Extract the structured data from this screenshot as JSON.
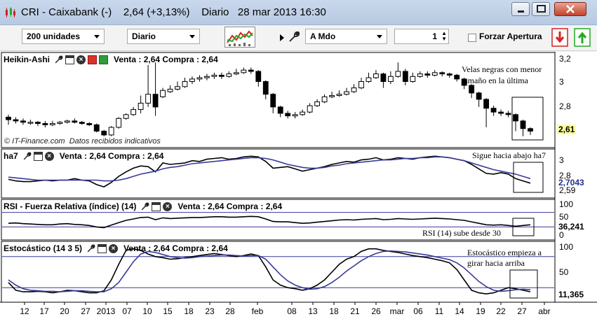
{
  "window": {
    "title": "CRI - Caixabank (-)",
    "quote": "2,64 (+3,13%)",
    "period": "Diario",
    "datetime": "28 mar 2013 16:30"
  },
  "toolbar": {
    "units": "200 unidades",
    "period": "Diario",
    "market": "A Mdo",
    "quantity": "1",
    "forzar_label": "Forzar Apertura"
  },
  "panels": {
    "price": {
      "name": "Heikin-Ashi",
      "quote": "Venta : 2,64 Compra : 2,64",
      "y_ticks": [
        "3,2",
        "3",
        "2,8"
      ],
      "last_value": "2,61",
      "credit_source": "© IT-Finance.com",
      "credit_note": "Datos recibidos indicativos",
      "annotation_line1": "Velas negras con menor",
      "annotation_line2": "tamaño en la última"
    },
    "ha7": {
      "name": "ha7",
      "quote": "Venta : 2,64 Compra : 2,64",
      "y_ticks": [
        "3",
        "2,8"
      ],
      "value_blue": "2,7043",
      "value_black": "2,59",
      "annotation": "Sigue hacia abajo ha7"
    },
    "rsi": {
      "name": "RSI - Fuerza Relativa (índice) (14)",
      "quote": "Venta : 2,64 Compra : 2,64",
      "y_ticks": [
        "100",
        "50",
        "0"
      ],
      "value": "36,241",
      "annotation": "RSI (14) sube desde 30"
    },
    "stoch": {
      "name": "Estocástico (14 3 5)",
      "quote": "Venta : 2,64 Compra : 2,64",
      "y_ticks": [
        "100",
        "50"
      ],
      "value": "11,365",
      "annotation_line1": "Estocástico empieza a",
      "annotation_line2": "girar  hacia arriba"
    }
  },
  "x_axis": [
    "12",
    "17",
    "20",
    "27",
    "2013",
    "07",
    "10",
    "15",
    "18",
    "23",
    "28",
    "feb",
    "08",
    "13",
    "18",
    "21",
    "26",
    "mar",
    "06",
    "11",
    "14",
    "19",
    "22",
    "27",
    "abr"
  ],
  "colors": {
    "bull_candle": "#ffffff",
    "bear_candle": "#000000",
    "ha7_blue": "#3a3a9a",
    "last_tag_bg": "#ffff99",
    "value_tag_blue": "#1f2f8f"
  },
  "chart_data": [
    {
      "type": "candlestick",
      "title": "Heikin-Ashi",
      "ylim": [
        2.58,
        3.24
      ],
      "candles": [
        {
          "o": 2.77,
          "c": 2.75,
          "h": 2.79,
          "l": 2.71
        },
        {
          "o": 2.75,
          "c": 2.74,
          "h": 2.77,
          "l": 2.72
        },
        {
          "o": 2.74,
          "c": 2.73,
          "h": 2.76,
          "l": 2.71
        },
        {
          "o": 2.73,
          "c": 2.73,
          "h": 2.75,
          "l": 2.71
        },
        {
          "o": 2.73,
          "c": 2.72,
          "h": 2.74,
          "l": 2.7
        },
        {
          "o": 2.72,
          "c": 2.71,
          "h": 2.74,
          "l": 2.69
        },
        {
          "o": 2.71,
          "c": 2.72,
          "h": 2.74,
          "l": 2.7
        },
        {
          "o": 2.72,
          "c": 2.73,
          "h": 2.74,
          "l": 2.71
        },
        {
          "o": 2.73,
          "c": 2.74,
          "h": 2.75,
          "l": 2.72
        },
        {
          "o": 2.74,
          "c": 2.73,
          "h": 2.76,
          "l": 2.72
        },
        {
          "o": 2.73,
          "c": 2.72,
          "h": 2.74,
          "l": 2.71
        },
        {
          "o": 2.72,
          "c": 2.71,
          "h": 2.73,
          "l": 2.7
        },
        {
          "o": 2.71,
          "c": 2.66,
          "h": 2.72,
          "l": 2.65
        },
        {
          "o": 2.66,
          "c": 2.63,
          "h": 2.67,
          "l": 2.62
        },
        {
          "o": 2.63,
          "c": 2.69,
          "h": 2.7,
          "l": 2.62
        },
        {
          "o": 2.69,
          "c": 2.76,
          "h": 2.77,
          "l": 2.68
        },
        {
          "o": 2.76,
          "c": 2.79,
          "h": 2.8,
          "l": 2.75
        },
        {
          "o": 2.79,
          "c": 2.83,
          "h": 2.85,
          "l": 2.78
        },
        {
          "o": 2.83,
          "c": 2.88,
          "h": 2.94,
          "l": 2.8
        },
        {
          "o": 2.88,
          "c": 2.95,
          "h": 3.18,
          "l": 2.85
        },
        {
          "o": 2.95,
          "c": 2.85,
          "h": 3.2,
          "l": 2.78
        },
        {
          "o": 2.93,
          "c": 2.98,
          "h": 3.0,
          "l": 2.92
        },
        {
          "o": 2.97,
          "c": 2.99,
          "h": 3.02,
          "l": 2.96
        },
        {
          "o": 2.99,
          "c": 3.01,
          "h": 3.05,
          "l": 2.98
        },
        {
          "o": 3.01,
          "c": 3.05,
          "h": 3.08,
          "l": 3.0
        },
        {
          "o": 3.05,
          "c": 3.07,
          "h": 3.09,
          "l": 3.03
        },
        {
          "o": 3.07,
          "c": 3.08,
          "h": 3.1,
          "l": 3.05
        },
        {
          "o": 3.08,
          "c": 3.09,
          "h": 3.11,
          "l": 3.06
        },
        {
          "o": 3.09,
          "c": 3.1,
          "h": 3.12,
          "l": 3.07
        },
        {
          "o": 3.1,
          "c": 3.09,
          "h": 3.12,
          "l": 3.07
        },
        {
          "o": 3.09,
          "c": 3.11,
          "h": 3.13,
          "l": 3.08
        },
        {
          "o": 3.11,
          "c": 3.12,
          "h": 3.15,
          "l": 3.1
        },
        {
          "o": 3.12,
          "c": 3.14,
          "h": 3.16,
          "l": 3.11
        },
        {
          "o": 3.14,
          "c": 3.13,
          "h": 3.16,
          "l": 3.11
        },
        {
          "o": 3.13,
          "c": 3.05,
          "h": 3.14,
          "l": 3.01
        },
        {
          "o": 3.05,
          "c": 2.95,
          "h": 3.06,
          "l": 2.91
        },
        {
          "o": 2.95,
          "c": 2.85,
          "h": 2.96,
          "l": 2.8
        },
        {
          "o": 2.85,
          "c": 2.8,
          "h": 2.86,
          "l": 2.77
        },
        {
          "o": 2.8,
          "c": 2.78,
          "h": 2.82,
          "l": 2.76
        },
        {
          "o": 2.78,
          "c": 2.79,
          "h": 2.81,
          "l": 2.76
        },
        {
          "o": 2.79,
          "c": 2.81,
          "h": 2.83,
          "l": 2.78
        },
        {
          "o": 2.81,
          "c": 2.86,
          "h": 2.88,
          "l": 2.8
        },
        {
          "o": 2.86,
          "c": 2.89,
          "h": 2.91,
          "l": 2.85
        },
        {
          "o": 2.89,
          "c": 2.93,
          "h": 2.95,
          "l": 2.88
        },
        {
          "o": 2.93,
          "c": 2.94,
          "h": 2.97,
          "l": 2.92
        },
        {
          "o": 2.94,
          "c": 2.95,
          "h": 2.98,
          "l": 2.93
        },
        {
          "o": 2.95,
          "c": 2.97,
          "h": 3.0,
          "l": 2.94
        },
        {
          "o": 2.97,
          "c": 3.0,
          "h": 3.03,
          "l": 2.96
        },
        {
          "o": 3.0,
          "c": 3.05,
          "h": 3.08,
          "l": 2.99
        },
        {
          "o": 3.05,
          "c": 3.08,
          "h": 3.12,
          "l": 3.04
        },
        {
          "o": 3.08,
          "c": 3.11,
          "h": 3.14,
          "l": 3.07
        },
        {
          "o": 3.11,
          "c": 3.05,
          "h": 3.12,
          "l": 3.0
        },
        {
          "o": 3.05,
          "c": 3.09,
          "h": 3.13,
          "l": 3.03
        },
        {
          "o": 3.09,
          "c": 3.13,
          "h": 3.2,
          "l": 3.08
        },
        {
          "o": 3.13,
          "c": 3.05,
          "h": 3.15,
          "l": 3.02
        },
        {
          "o": 3.05,
          "c": 3.09,
          "h": 3.12,
          "l": 3.04
        },
        {
          "o": 3.09,
          "c": 3.11,
          "h": 3.13,
          "l": 3.08
        },
        {
          "o": 3.11,
          "c": 3.1,
          "h": 3.13,
          "l": 3.08
        },
        {
          "o": 3.1,
          "c": 3.12,
          "h": 3.14,
          "l": 3.09
        },
        {
          "o": 3.12,
          "c": 3.11,
          "h": 3.13,
          "l": 3.09
        },
        {
          "o": 3.11,
          "c": 3.1,
          "h": 3.12,
          "l": 3.08
        },
        {
          "o": 3.1,
          "c": 3.07,
          "h": 3.11,
          "l": 3.05
        },
        {
          "o": 3.07,
          "c": 3.02,
          "h": 3.08,
          "l": 2.99
        },
        {
          "o": 3.02,
          "c": 2.96,
          "h": 3.03,
          "l": 2.92
        },
        {
          "o": 2.96,
          "c": 2.91,
          "h": 2.97,
          "l": 2.85
        },
        {
          "o": 2.91,
          "c": 2.84,
          "h": 2.92,
          "l": 2.69
        },
        {
          "o": 2.84,
          "c": 2.81,
          "h": 2.86,
          "l": 2.78
        },
        {
          "o": 2.81,
          "c": 2.8,
          "h": 2.83,
          "l": 2.78
        },
        {
          "o": 2.8,
          "c": 2.79,
          "h": 2.82,
          "l": 2.77
        },
        {
          "o": 2.79,
          "c": 2.74,
          "h": 2.8,
          "l": 2.66
        },
        {
          "o": 2.74,
          "c": 2.68,
          "h": 2.75,
          "l": 2.62
        },
        {
          "o": 2.68,
          "c": 2.66,
          "h": 2.69,
          "l": 2.63
        }
      ]
    },
    {
      "type": "line",
      "title": "ha7",
      "ylim": [
        2.5,
        3.08
      ],
      "series": [
        {
          "color": "black",
          "values": [
            2.73,
            2.71,
            2.7,
            2.7,
            2.71,
            2.72,
            2.71,
            2.72,
            2.72,
            2.74,
            2.72,
            2.71,
            2.66,
            2.63,
            2.69,
            2.77,
            2.83,
            2.88,
            2.91,
            2.9,
            2.83,
            2.95,
            2.93,
            2.94,
            2.95,
            2.98,
            2.97,
            3.0,
            3.01,
            3.02,
            3.0,
            3.01,
            3.03,
            3.04,
            3.03,
            2.97,
            2.88,
            2.89,
            2.9,
            2.87,
            2.84,
            2.86,
            2.88,
            2.9,
            2.93,
            2.95,
            2.97,
            2.96,
            2.99,
            3.0,
            3.02,
            2.99,
            3.0,
            3.02,
            3.01,
            3.0,
            3.02,
            3.03,
            3.04,
            3.03,
            3.02,
            3.0,
            2.98,
            2.93,
            2.87,
            2.81,
            2.8,
            2.82,
            2.8,
            2.74,
            2.71,
            2.68
          ]
        },
        {
          "color": "blue",
          "values": [
            2.76,
            2.75,
            2.74,
            2.73,
            2.72,
            2.72,
            2.72,
            2.72,
            2.72,
            2.72,
            2.72,
            2.72,
            2.72,
            2.71,
            2.71,
            2.72,
            2.74,
            2.77,
            2.8,
            2.82,
            2.84,
            2.87,
            2.89,
            2.9,
            2.92,
            2.94,
            2.95,
            2.96,
            2.97,
            2.98,
            2.99,
            3.0,
            3.01,
            3.02,
            3.02,
            3.01,
            2.99,
            2.96,
            2.93,
            2.91,
            2.89,
            2.88,
            2.88,
            2.89,
            2.91,
            2.92,
            2.94,
            2.95,
            2.96,
            2.97,
            2.98,
            2.99,
            2.99,
            3.0,
            3.01,
            3.01,
            3.02,
            3.02,
            3.03,
            3.03,
            3.02,
            3.0,
            2.98,
            2.95,
            2.92,
            2.89,
            2.86,
            2.84,
            2.82,
            2.8,
            2.77,
            2.74
          ]
        }
      ]
    },
    {
      "type": "line",
      "title": "RSI - Fuerza Relativa (índice) (14)",
      "ylim": [
        0,
        100
      ],
      "levels": [
        70,
        30
      ],
      "series": [
        {
          "color": "black",
          "values": [
            40,
            41,
            39,
            38,
            37,
            36,
            36,
            38,
            39,
            37,
            36,
            34,
            30,
            28,
            35,
            42,
            48,
            52,
            56,
            57,
            50,
            55,
            53,
            54,
            55,
            56,
            56,
            57,
            58,
            58,
            57,
            57,
            58,
            59,
            58,
            52,
            45,
            44,
            44,
            42,
            40,
            41,
            43,
            45,
            47,
            49,
            50,
            49,
            51,
            52,
            53,
            50,
            51,
            53,
            52,
            51,
            52,
            53,
            54,
            53,
            52,
            50,
            48,
            44,
            40,
            36,
            35,
            36,
            34,
            32,
            34,
            36
          ]
        }
      ]
    },
    {
      "type": "line",
      "title": "Estocástico (14 3 5)",
      "ylim": [
        0,
        100
      ],
      "levels": [
        80,
        20
      ],
      "series": [
        {
          "color": "black",
          "values": [
            30,
            15,
            12,
            12,
            13,
            12,
            10,
            12,
            15,
            14,
            12,
            10,
            10,
            14,
            35,
            65,
            92,
            95,
            92,
            85,
            80,
            78,
            75,
            76,
            78,
            80,
            82,
            84,
            86,
            84,
            82,
            80,
            82,
            85,
            82,
            60,
            35,
            25,
            20,
            18,
            15,
            18,
            25,
            35,
            50,
            65,
            75,
            80,
            90,
            95,
            95,
            92,
            90,
            88,
            85,
            82,
            80,
            78,
            75,
            72,
            68,
            55,
            35,
            15,
            10,
            8,
            10,
            15,
            20,
            18,
            15,
            12
          ]
        },
        {
          "color": "blue",
          "values": [
            35,
            25,
            18,
            15,
            14,
            13,
            13,
            12,
            13,
            14,
            14,
            13,
            12,
            12,
            18,
            30,
            50,
            70,
            85,
            90,
            88,
            84,
            80,
            78,
            77,
            78,
            80,
            81,
            82,
            83,
            83,
            82,
            81,
            82,
            82,
            75,
            60,
            45,
            33,
            25,
            20,
            17,
            18,
            22,
            30,
            40,
            52,
            62,
            72,
            80,
            86,
            90,
            91,
            90,
            89,
            87,
            85,
            83,
            80,
            77,
            74,
            68,
            58,
            45,
            32,
            22,
            15,
            13,
            14,
            16,
            17,
            16
          ]
        }
      ]
    }
  ]
}
